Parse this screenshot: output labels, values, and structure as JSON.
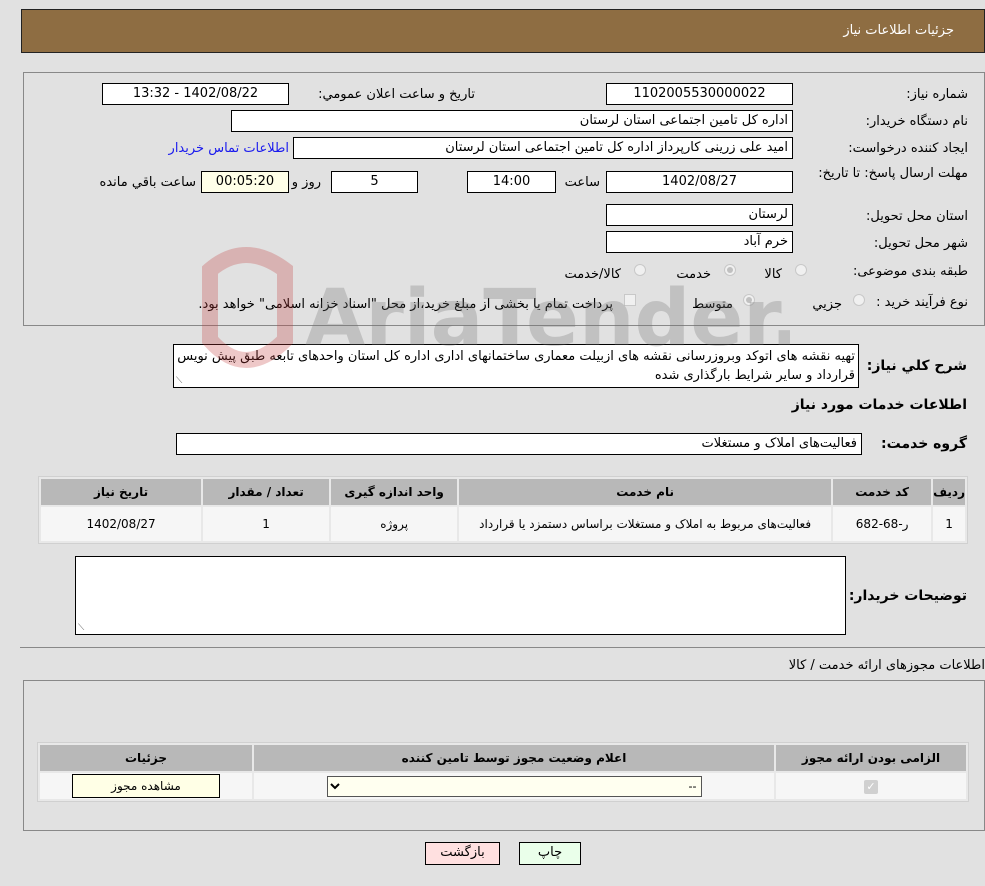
{
  "header": {
    "title": "جزئیات اطلاعات نیاز"
  },
  "form": {
    "need_number_label": "شماره نیاز:",
    "need_number": "1102005530000022",
    "announce_label": "تاریخ و ساعت اعلان عمومي:",
    "announce_value": "1402/08/22 - 13:32",
    "buyer_org_label": "نام دستگاه خریدار:",
    "buyer_org": "اداره کل تامین اجتماعی استان لرستان",
    "creator_label": "ایجاد کننده درخواست:",
    "creator": "امید علی زرینی کارپرداز اداره کل تامین اجتماعی استان لرستان",
    "contact_link": "اطلاعات تماس خریدار",
    "deadline_label": "مهلت ارسال پاسخ: تا تاریخ:",
    "deadline_date": "1402/08/27",
    "time_label": "ساعت",
    "deadline_time": "14:00",
    "days_value": "5",
    "days_label": "روز و",
    "remaining_time": "00:05:20",
    "remaining_label": "ساعت باقي مانده",
    "province_label": "استان محل تحویل:",
    "province": "لرستان",
    "city_label": "شهر محل تحویل:",
    "city": "خرم آباد",
    "category_label": "طبقه بندی موضوعی:",
    "category_options": [
      "کالا",
      "خدمت",
      "کالا/خدمت"
    ],
    "category_selected": "خدمت",
    "process_label": "نوع فرآیند خرید :",
    "process_options": [
      "جزيي",
      "متوسط"
    ],
    "process_selected": "متوسط",
    "treasury_note": "پرداخت تمام یا بخشی از مبلغ خرید،از محل \"اسناد خزانه اسلامی\" خواهد بود."
  },
  "description": {
    "label": "شرح کلي نياز:",
    "text": "تهیه نقشه های اتوکد وبروزرسانی نقشه های ازبیلت معماری ساختمانهای اداری اداره کل استان واحدهای تابعه طبق پیش نویس قرارداد و سایر شرایط بارگذاری شده"
  },
  "services": {
    "section_title": "اطلاعات خدمات مورد نیاز",
    "group_label": "گروه خدمت:",
    "group_value": "فعالیت‌های  املاک و مستغلات",
    "columns": [
      "رديف",
      "کد خدمت",
      "نام خدمت",
      "واحد اندازه گیری",
      "تعداد / مقدار",
      "تاریخ نیاز"
    ],
    "rows": [
      {
        "index": "1",
        "code": "ر-68-682",
        "name": "فعالیت‌های مربوط به املاک و مستغلات براساس دستمزد یا قرارداد",
        "unit": "پروژه",
        "qty": "1",
        "date": "1402/08/27"
      }
    ]
  },
  "buyer_notes": {
    "label": "توضیحات خریدار:",
    "text": ""
  },
  "permits": {
    "section_title": "اطلاعات مجوزهای ارائه خدمت / کالا",
    "columns": [
      "الزامی بودن ارائه مجوز",
      "اعلام وضعیت مجوز توسط تامین کننده",
      "جزئیات"
    ],
    "rows": [
      {
        "required": true,
        "status": "--",
        "details_button": "مشاهده مجوز"
      }
    ]
  },
  "actions": {
    "print": "چاپ",
    "back": "بازگشت"
  },
  "watermark": {
    "text": "AriaTender.neT"
  },
  "colors": {
    "header": "#8e6d42",
    "print_bg": "#eaffea",
    "back_bg": "#ffe0e0",
    "link": "#1a1aee"
  }
}
